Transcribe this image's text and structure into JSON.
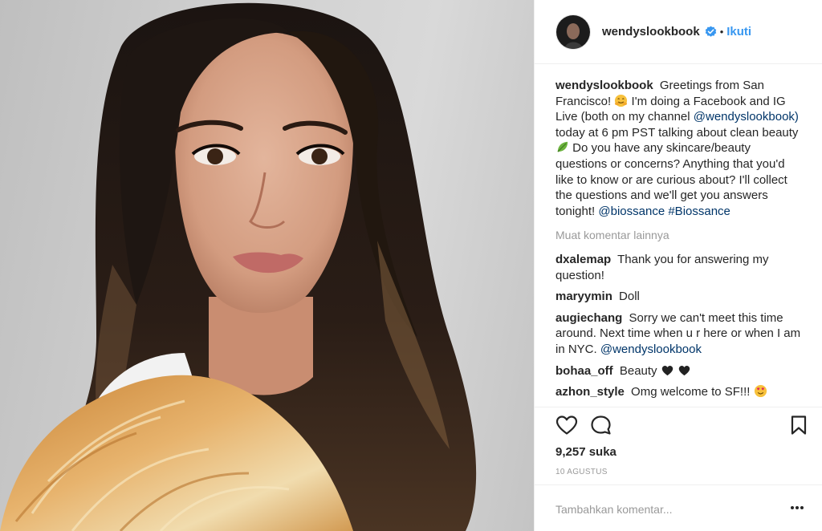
{
  "header": {
    "username": "wendyslookbook",
    "separator": "•",
    "follow_label": "Ikuti"
  },
  "caption": {
    "username": "wendyslookbook",
    "text_1": "Greetings from San Francisco!",
    "text_2": "I'm doing a Facebook and IG Live (both on my channel",
    "mention_1": "@wendyslookbook)",
    "text_3": "today at 6 pm PST talking about clean beauty",
    "text_4": "Do you have any skincare/beauty questions or concerns? Anything that you'd like to know or are curious about? I'll collect the questions and we'll get you answers tonight!",
    "mention_2": "@biossance",
    "hashtag": "#Biossance"
  },
  "load_more_label": "Muat komentar lainnya",
  "comments": [
    {
      "user": "dxalemap",
      "text": "Thank you for answering my question!"
    },
    {
      "user": "maryymin",
      "text": "Doll"
    },
    {
      "user": "augiechang",
      "text": "Sorry we can't meet this time around. Next time when u r here or when I am in NYC.",
      "mention": "@wendyslookbook"
    },
    {
      "user": "bohaa_off",
      "text": "Beauty"
    },
    {
      "user": "azhon_style",
      "text": "Omg welcome to SF!!!"
    }
  ],
  "likes_label": "9,257 suka",
  "date_label": "10 AGUSTUS",
  "add_comment_placeholder": "Tambahkan komentar...",
  "icons": {
    "like": "heart-outline-icon",
    "comment": "speech-bubble-icon",
    "save": "bookmark-icon",
    "more": "ellipsis-icon",
    "verified": "verified-badge-icon"
  },
  "colors": {
    "link": "#003569",
    "follow": "#3897f0",
    "muted": "#999999",
    "verified": "#3897f0"
  }
}
